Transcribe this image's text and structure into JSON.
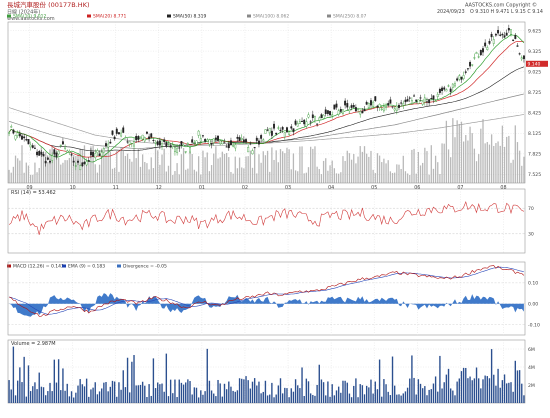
{
  "header": {
    "title": "長城汽車股份 (00177B.HK)",
    "period": "日線 (2024年)",
    "copyright": "AASTOCKS.com Copyright ©",
    "quote": "O 9.310 H 9.471 L 9.15 C 9.14",
    "date": "2024/09/23",
    "site": "www.aastocks.com"
  },
  "legend_main": [
    {
      "label": "SMA(10) 9.012",
      "color": "#3c9c3c"
    },
    {
      "label": "SMA(20) 8.771",
      "color": "#cc2222"
    },
    {
      "label": "SMA(50) 8.319",
      "color": "#222222"
    },
    {
      "label": "SMA(100) 8.062",
      "color": "#888888"
    },
    {
      "label": "SMA(250) 8.07",
      "color": "#888888"
    }
  ],
  "rsi_label": "RSI (14) = 53.462",
  "macd_legend": [
    {
      "label": "MACD (12,26) = 0.143",
      "color": "#b01010"
    },
    {
      "label": "EMA (9) = 0.183",
      "color": "#1a3fb0"
    },
    {
      "label": "Divergence = -0.05",
      "color": "#3a6fbf"
    }
  ],
  "volume_label": "Volume = 2.987M",
  "colors": {
    "up": "#3a9a3a",
    "down": "#222222",
    "sma10": "#2e9e2e",
    "sma20": "#d12b2b",
    "sma50": "#222222",
    "sma100": "#8a8a8a",
    "sma250": "#a0a0a0",
    "rsi": "#d13a3a",
    "macd": "#b01010",
    "signal": "#2646b8",
    "divergence": "#2b6cc4",
    "vol": "#2b4f8f",
    "grid": "#d8d8d8",
    "price_bars": "#9a9a9a"
  },
  "chart_data": {
    "type": "candlestick",
    "x_ticks": [
      "09",
      "10",
      "11",
      "12",
      "01",
      "02",
      "03",
      "04",
      "05",
      "06",
      "07",
      "08"
    ],
    "price_axis": {
      "ticks": [
        7.525,
        7.825,
        8.125,
        8.425,
        8.725,
        9.025,
        9.325,
        9.625
      ],
      "range": [
        7.4,
        9.75
      ],
      "current": 9.14
    },
    "price_anchors": [
      8.2,
      8.05,
      7.85,
      7.7,
      7.95,
      7.65,
      7.75,
      7.9,
      8.15,
      8.0,
      8.1,
      7.95,
      7.95,
      7.9,
      8.1,
      8.0,
      7.95,
      8.05,
      7.9,
      8.15,
      8.15,
      8.2,
      8.35,
      8.3,
      8.45,
      8.5,
      8.45,
      8.55,
      8.5,
      8.55,
      8.65,
      8.6,
      8.7,
      8.85,
      9.15,
      9.35,
      9.55,
      9.6,
      9.2
    ],
    "rsi_axis": {
      "ticks": [
        70,
        30
      ],
      "range": [
        0,
        100
      ]
    },
    "rsi_anchors": [
      45,
      60,
      35,
      50,
      55,
      40,
      55,
      62,
      52,
      58,
      60,
      50,
      55,
      45,
      52,
      60,
      55,
      48,
      58,
      62,
      55,
      50,
      60,
      58,
      62,
      55,
      50,
      62,
      66,
      70,
      68,
      74,
      70,
      72,
      70,
      62
    ],
    "macd_axis": {
      "ticks": [
        0.1,
        0.0,
        -0.1
      ],
      "range": [
        -0.15,
        0.2
      ]
    },
    "macd_anchors": [
      0.03,
      -0.02,
      -0.06,
      -0.03,
      -0.01,
      -0.04,
      0.0,
      0.02,
      0.0,
      0.03,
      0.01,
      -0.02,
      0.01,
      -0.01,
      0.02,
      0.03,
      0.05,
      0.04,
      0.06,
      0.06,
      0.08,
      0.1,
      0.12,
      0.13,
      0.15,
      0.14,
      0.13,
      0.12,
      0.13,
      0.16,
      0.18,
      0.16,
      0.143
    ],
    "volume_axis": {
      "ticks": [
        "6M",
        "4M",
        "2M"
      ],
      "range": [
        0,
        7
      ]
    }
  }
}
